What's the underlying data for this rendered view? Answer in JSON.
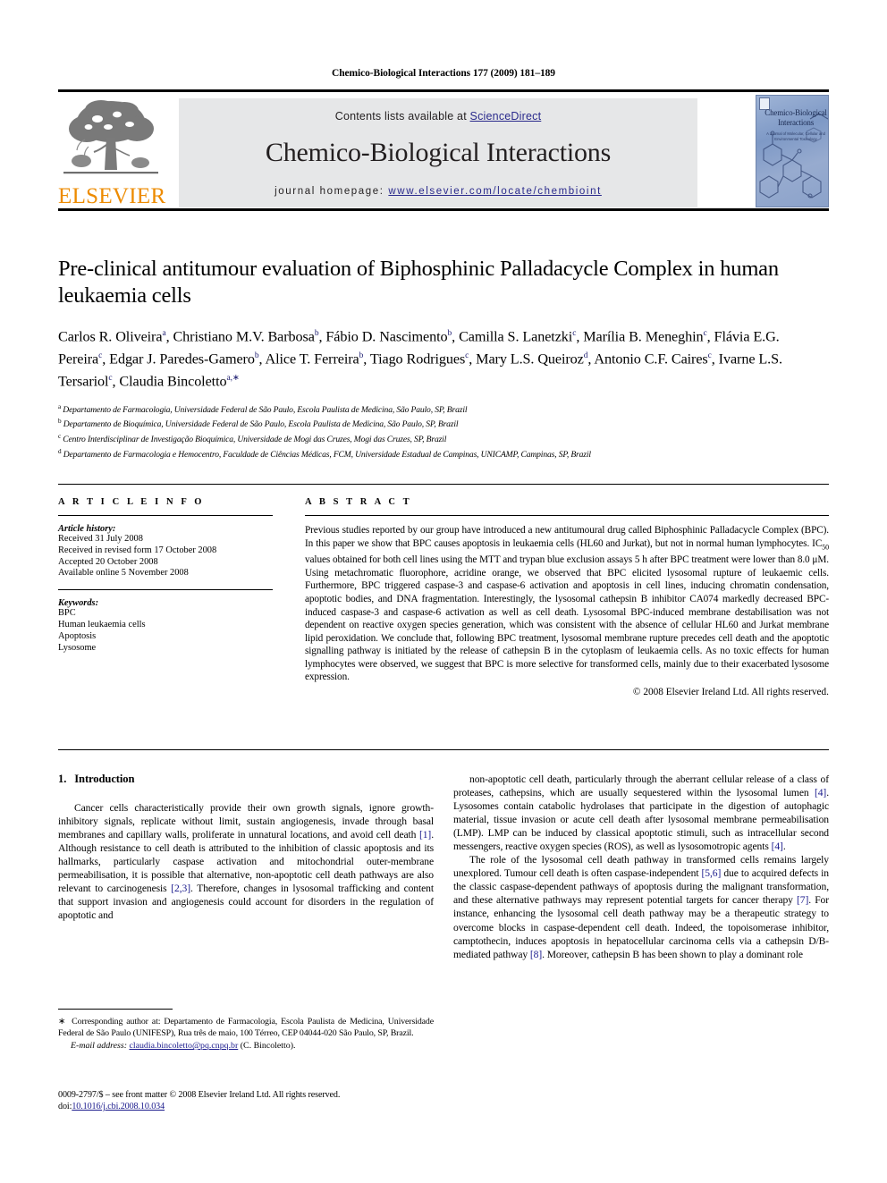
{
  "running_head": "Chemico-Biological Interactions 177 (2009) 181–189",
  "masthead": {
    "contents_prefix": "Contents lists available at ",
    "sciencedirect": "ScienceDirect",
    "journal_title": "Chemico-Biological Interactions",
    "homepage_prefix": "journal homepage:",
    "homepage_url": "www.elsevier.com/locate/chembioint",
    "publisher": "ELSEVIER",
    "cover_title": "Chemico-Biological Interactions",
    "cover_subtitle": "A Journal of Molecular, Cellular and Environmental Toxicology",
    "accent_blue": "#2a2a8c",
    "elsevier_orange": "#ed8b00",
    "band_gray": "#e6e7e8"
  },
  "article": {
    "title": "Pre-clinical antitumour evaluation of Biphosphinic Palladacycle Complex in human leukaemia cells",
    "authors_html": "Carlos R. Oliveira<sup>a</sup>, Christiano M.V. Barbosa<sup>b</sup>, Fábio D. Nascimento<sup>b</sup>, Camilla S. Lanetzki<sup>c</sup>, Marília B. Meneghin<sup>c</sup>, Flávia E.G. Pereira<sup>c</sup>, Edgar J. Paredes-Gamero<sup>b</sup>, Alice T. Ferreira<sup>b</sup>, Tiago Rodrigues<sup>c</sup>, Mary L.S. Queiroz<sup>d</sup>, Antonio C.F. Caires<sup>c</sup>, Ivarne L.S. Tersariol<sup>c</sup>, Claudia Bincoletto<sup>a,∗</sup>",
    "affiliations": [
      {
        "mark": "a",
        "text": "Departamento de Farmacologia, Universidade Federal de São Paulo, Escola Paulista de Medicina, São Paulo, SP, Brazil"
      },
      {
        "mark": "b",
        "text": "Departamento de Bioquímica, Universidade Federal de São Paulo, Escola Paulista de Medicina, São Paulo, SP, Brazil"
      },
      {
        "mark": "c",
        "text": "Centro Interdisciplinar de Investigação Bioquímica, Universidade de Mogi das Cruzes, Mogi das Cruzes, SP, Brazil"
      },
      {
        "mark": "d",
        "text": "Departamento de Farmacologia e Hemocentro, Faculdade de Ciências Médicas, FCM, Universidade Estadual de Campinas, UNICAMP, Campinas, SP, Brazil"
      }
    ]
  },
  "info": {
    "heading": "A R T I C L E    I N F O",
    "history_label": "Article history:",
    "history": [
      "Received 31 July 2008",
      "Received in revised form 17 October 2008",
      "Accepted 20 October 2008",
      "Available online 5 November 2008"
    ],
    "keywords_label": "Keywords:",
    "keywords": [
      "BPC",
      "Human leukaemia cells",
      "Apoptosis",
      "Lysosome"
    ]
  },
  "abstract": {
    "heading": "A B S T R A C T",
    "body_html": "Previous studies reported by our group have introduced a new antitumoural drug called Biphosphinic Palladacycle Complex (BPC). In this paper we show that BPC causes apoptosis in leukaemia cells (HL60 and Jurkat), but not in normal human lymphocytes. IC<sub>50</sub> values obtained for both cell lines using the MTT and trypan blue exclusion assays 5&nbsp;h after BPC treatment were lower than 8.0&nbsp;μM. Using metachromatic fluorophore, acridine orange, we observed that BPC elicited lysosomal rupture of leukaemic cells. Furthermore, BPC triggered caspase-3 and caspase-6 activation and apoptosis in cell lines, inducing chromatin condensation, apoptotic bodies, and DNA fragmentation. Interestingly, the lysosomal cathepsin B inhibitor CA074 markedly decreased BPC-induced caspase-3 and caspase-6 activation as well as cell death. Lysosomal BPC-induced membrane destabilisation was not dependent on reactive oxygen species generation, which was consistent with the absence of cellular HL60 and Jurkat membrane lipid peroxidation. We conclude that, following BPC treatment, lysosomal membrane rupture precedes cell death and the apoptotic signalling pathway is initiated by the release of cathepsin B in the cytoplasm of leukaemia cells. As no toxic effects for human lymphocytes were observed, we suggest that BPC is more selective for transformed cells, mainly due to their exacerbated lysosome expression.",
    "copyright": "© 2008 Elsevier Ireland Ltd. All rights reserved."
  },
  "body": {
    "section_number": "1.",
    "section_title": "Introduction",
    "left_paragraph_html": "Cancer cells characteristically provide their own growth signals, ignore growth-inhibitory signals, replicate without limit, sustain angiogenesis, invade through basal membranes and capillary walls, proliferate in unnatural locations, and avoid cell death <span class=\"ref\">[1]</span>. Although resistance to cell death is attributed to the inhibition of classic apoptosis and its hallmarks, particularly caspase activation and mitochondrial outer-membrane permeabilisation, it is possible that alternative, non-apoptotic cell death pathways are also relevant to carcinogenesis <span class=\"ref\">[2,3]</span>. Therefore, changes in lysosomal trafficking and content that support invasion and angiogenesis could account for disorders in the regulation of apoptotic and",
    "right_paragraph1_html": "non-apoptotic cell death, particularly through the aberrant cellular release of a class of proteases, cathepsins, which are usually sequestered within the lysosomal lumen <span class=\"ref\">[4]</span>. Lysosomes contain catabolic hydrolases that participate in the digestion of autophagic material, tissue invasion or acute cell death after lysosomal membrane permeabilisation (LMP). LMP can be induced by classical apoptotic stimuli, such as intracellular second messengers, reactive oxygen species (ROS), as well as lysosomotropic agents <span class=\"ref\">[4]</span>.",
    "right_paragraph2_html": "The role of the lysosomal cell death pathway in transformed cells remains largely unexplored. Tumour cell death is often caspase-independent <span class=\"ref\">[5,6]</span> due to acquired defects in the classic caspase-dependent pathways of apoptosis during the malignant transformation, and these alternative pathways may represent potential targets for cancer therapy <span class=\"ref\">[7]</span>. For instance, enhancing the lysosomal cell death pathway may be a therapeutic strategy to overcome blocks in caspase-dependent cell death. Indeed, the topoisomerase inhibitor, camptothecin, induces apoptosis in hepatocellular carcinoma cells via a cathepsin D/B-mediated pathway <span class=\"ref\">[8]</span>. Moreover, cathepsin B has been shown to play a dominant role"
  },
  "footnote": {
    "star": "∗",
    "corresponding_html": "Corresponding author at: Departamento de Farmacologia, Escola Paulista de Medicina, Universidade Federal de São Paulo (UNIFESP), Rua três de maio, 100 Térreo, CEP 04044-020 São Paulo, SP, Brazil.",
    "email_label": "E-mail address:",
    "email": "claudia.bincoletto@pq.cnpq.br",
    "email_attrib": "(C. Bincoletto)."
  },
  "imprint": {
    "line1": "0009-2797/$ – see front matter © 2008 Elsevier Ireland Ltd. All rights reserved.",
    "doi_label": "doi:",
    "doi": "10.1016/j.cbi.2008.10.034"
  }
}
